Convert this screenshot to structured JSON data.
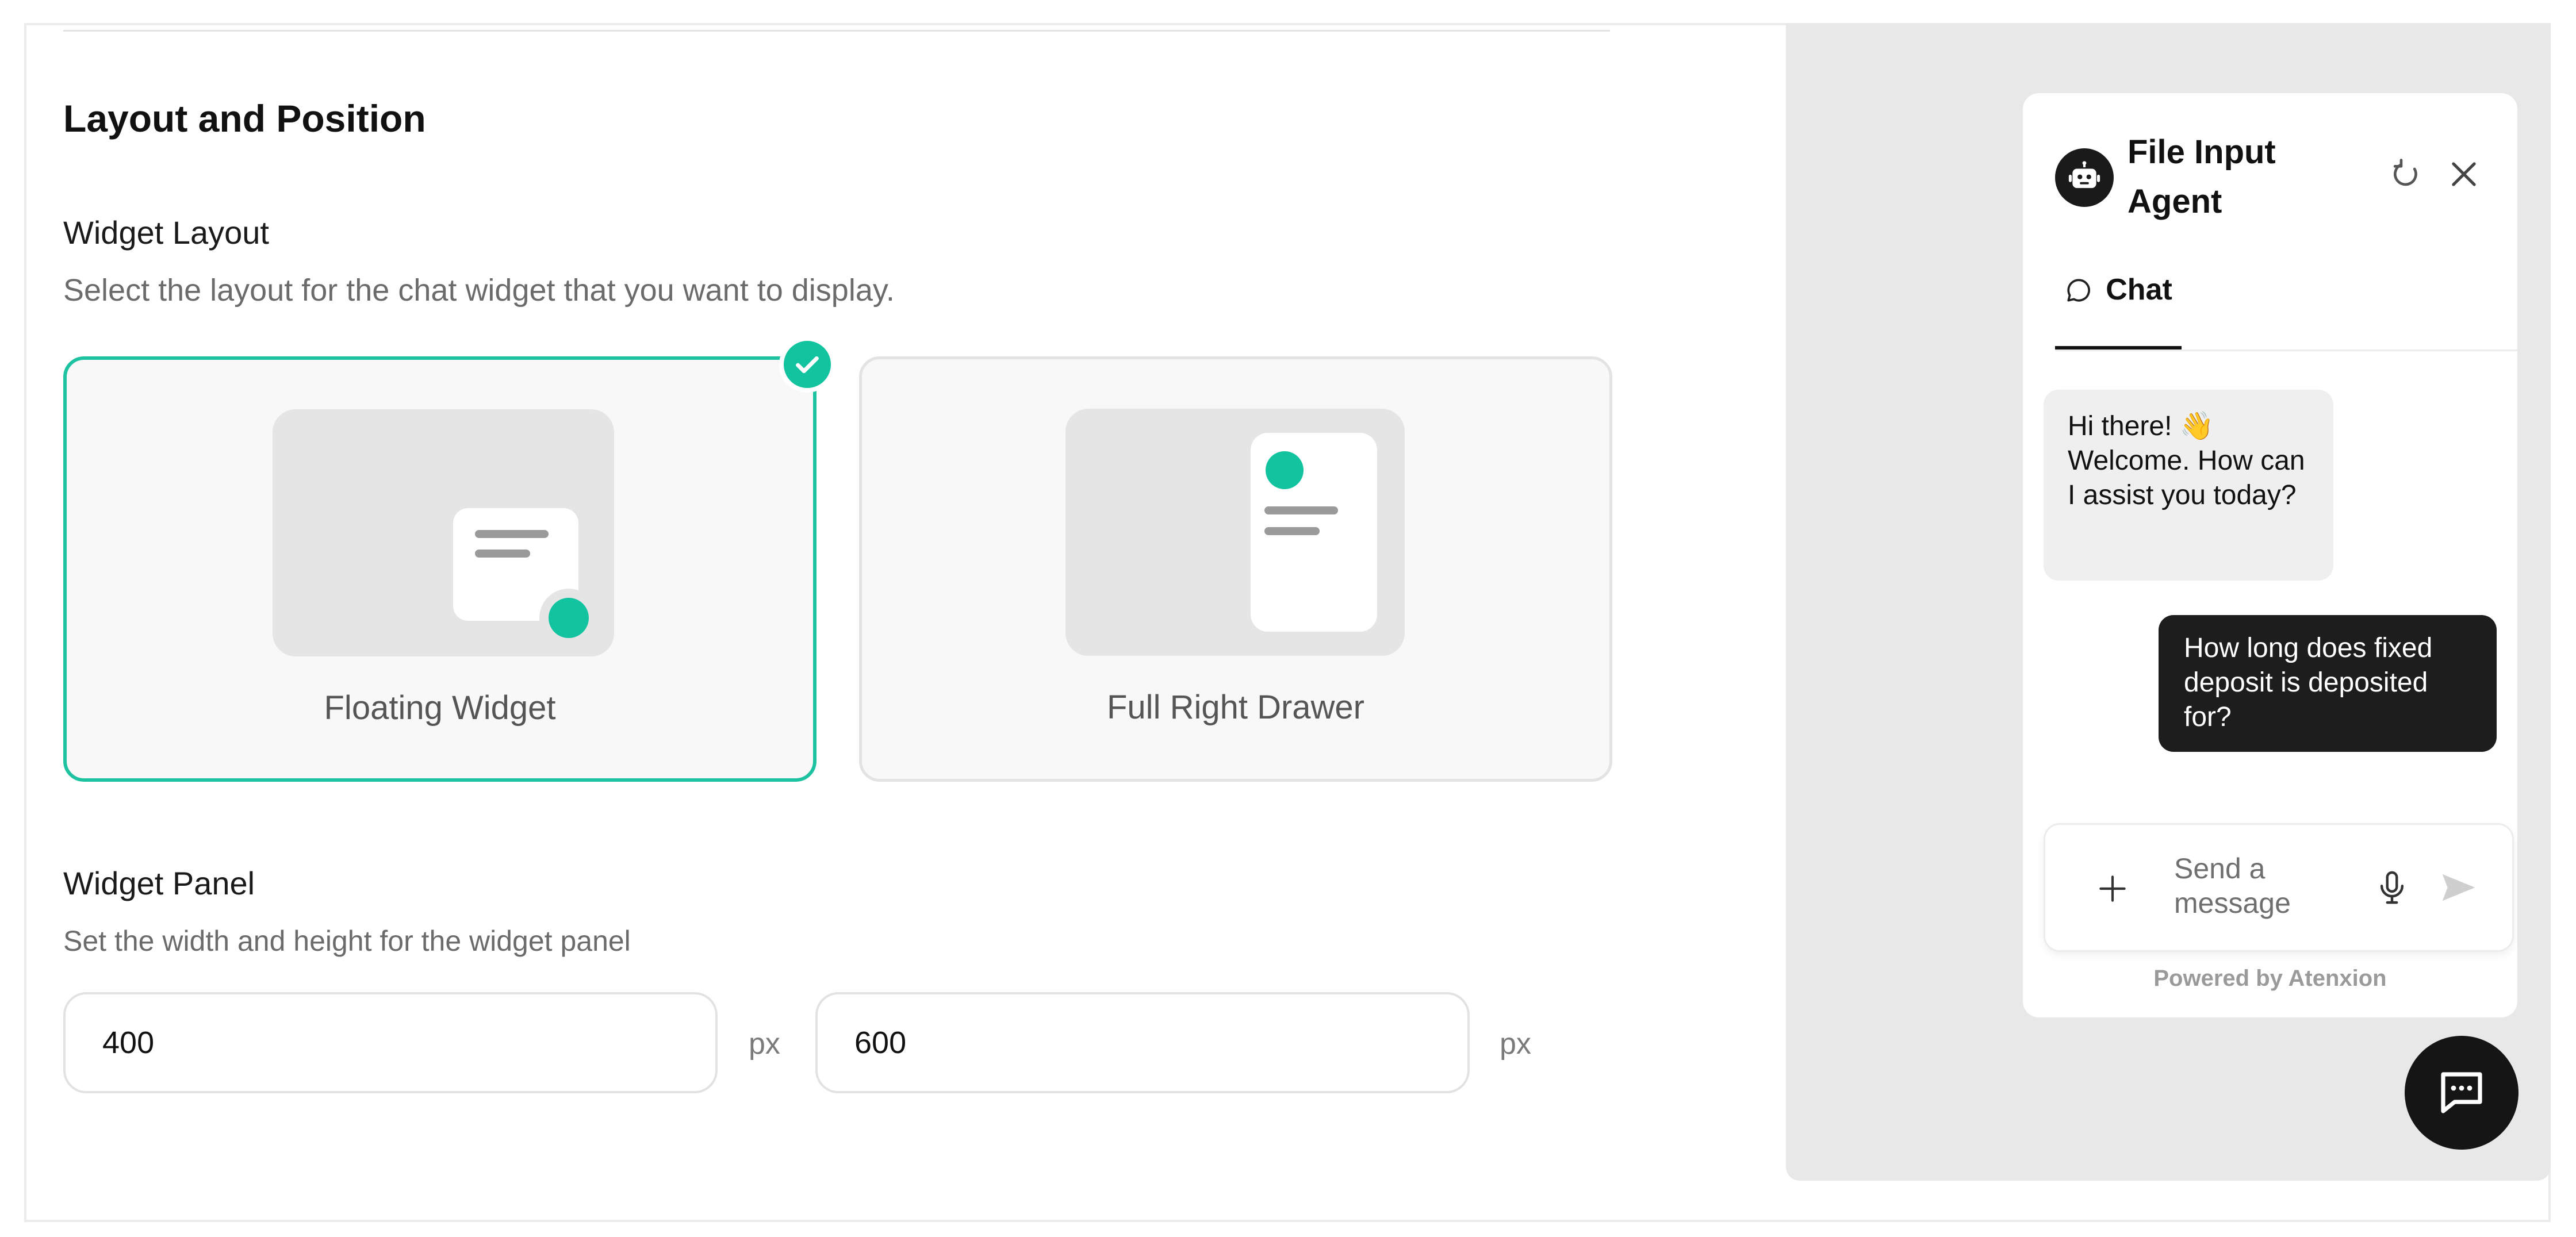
{
  "settings": {
    "section_title": "Layout and Position",
    "widget_layout": {
      "label": "Widget Layout",
      "description": "Select the layout for the chat widget that you want to display.",
      "options": [
        {
          "label": "Floating Widget",
          "selected": true
        },
        {
          "label": "Full Right Drawer",
          "selected": false
        }
      ]
    },
    "widget_panel": {
      "label": "Widget Panel",
      "description": "Set the width and height for the widget panel",
      "width_value": "400",
      "height_value": "600",
      "unit": "px"
    }
  },
  "preview": {
    "agent_name": "File Input Agent",
    "tab_label": "Chat",
    "messages": [
      {
        "role": "bot",
        "text": "Hi there! 👋 Welcome. How can I assist you today?"
      },
      {
        "role": "user",
        "text": "How long does fixed deposit is deposited for?"
      }
    ],
    "composer_placeholder": "Send a message",
    "powered_by": "Powered by Atenxion"
  },
  "colors": {
    "accent": "#12c3a0",
    "dark": "#1d1d1d",
    "preview_bg": "#e8e8e8"
  },
  "icons": [
    "check-icon",
    "bot-icon",
    "refresh-icon",
    "close-icon",
    "chat-bubble-icon",
    "plus-icon",
    "microphone-icon",
    "send-icon",
    "message-launcher-icon"
  ]
}
